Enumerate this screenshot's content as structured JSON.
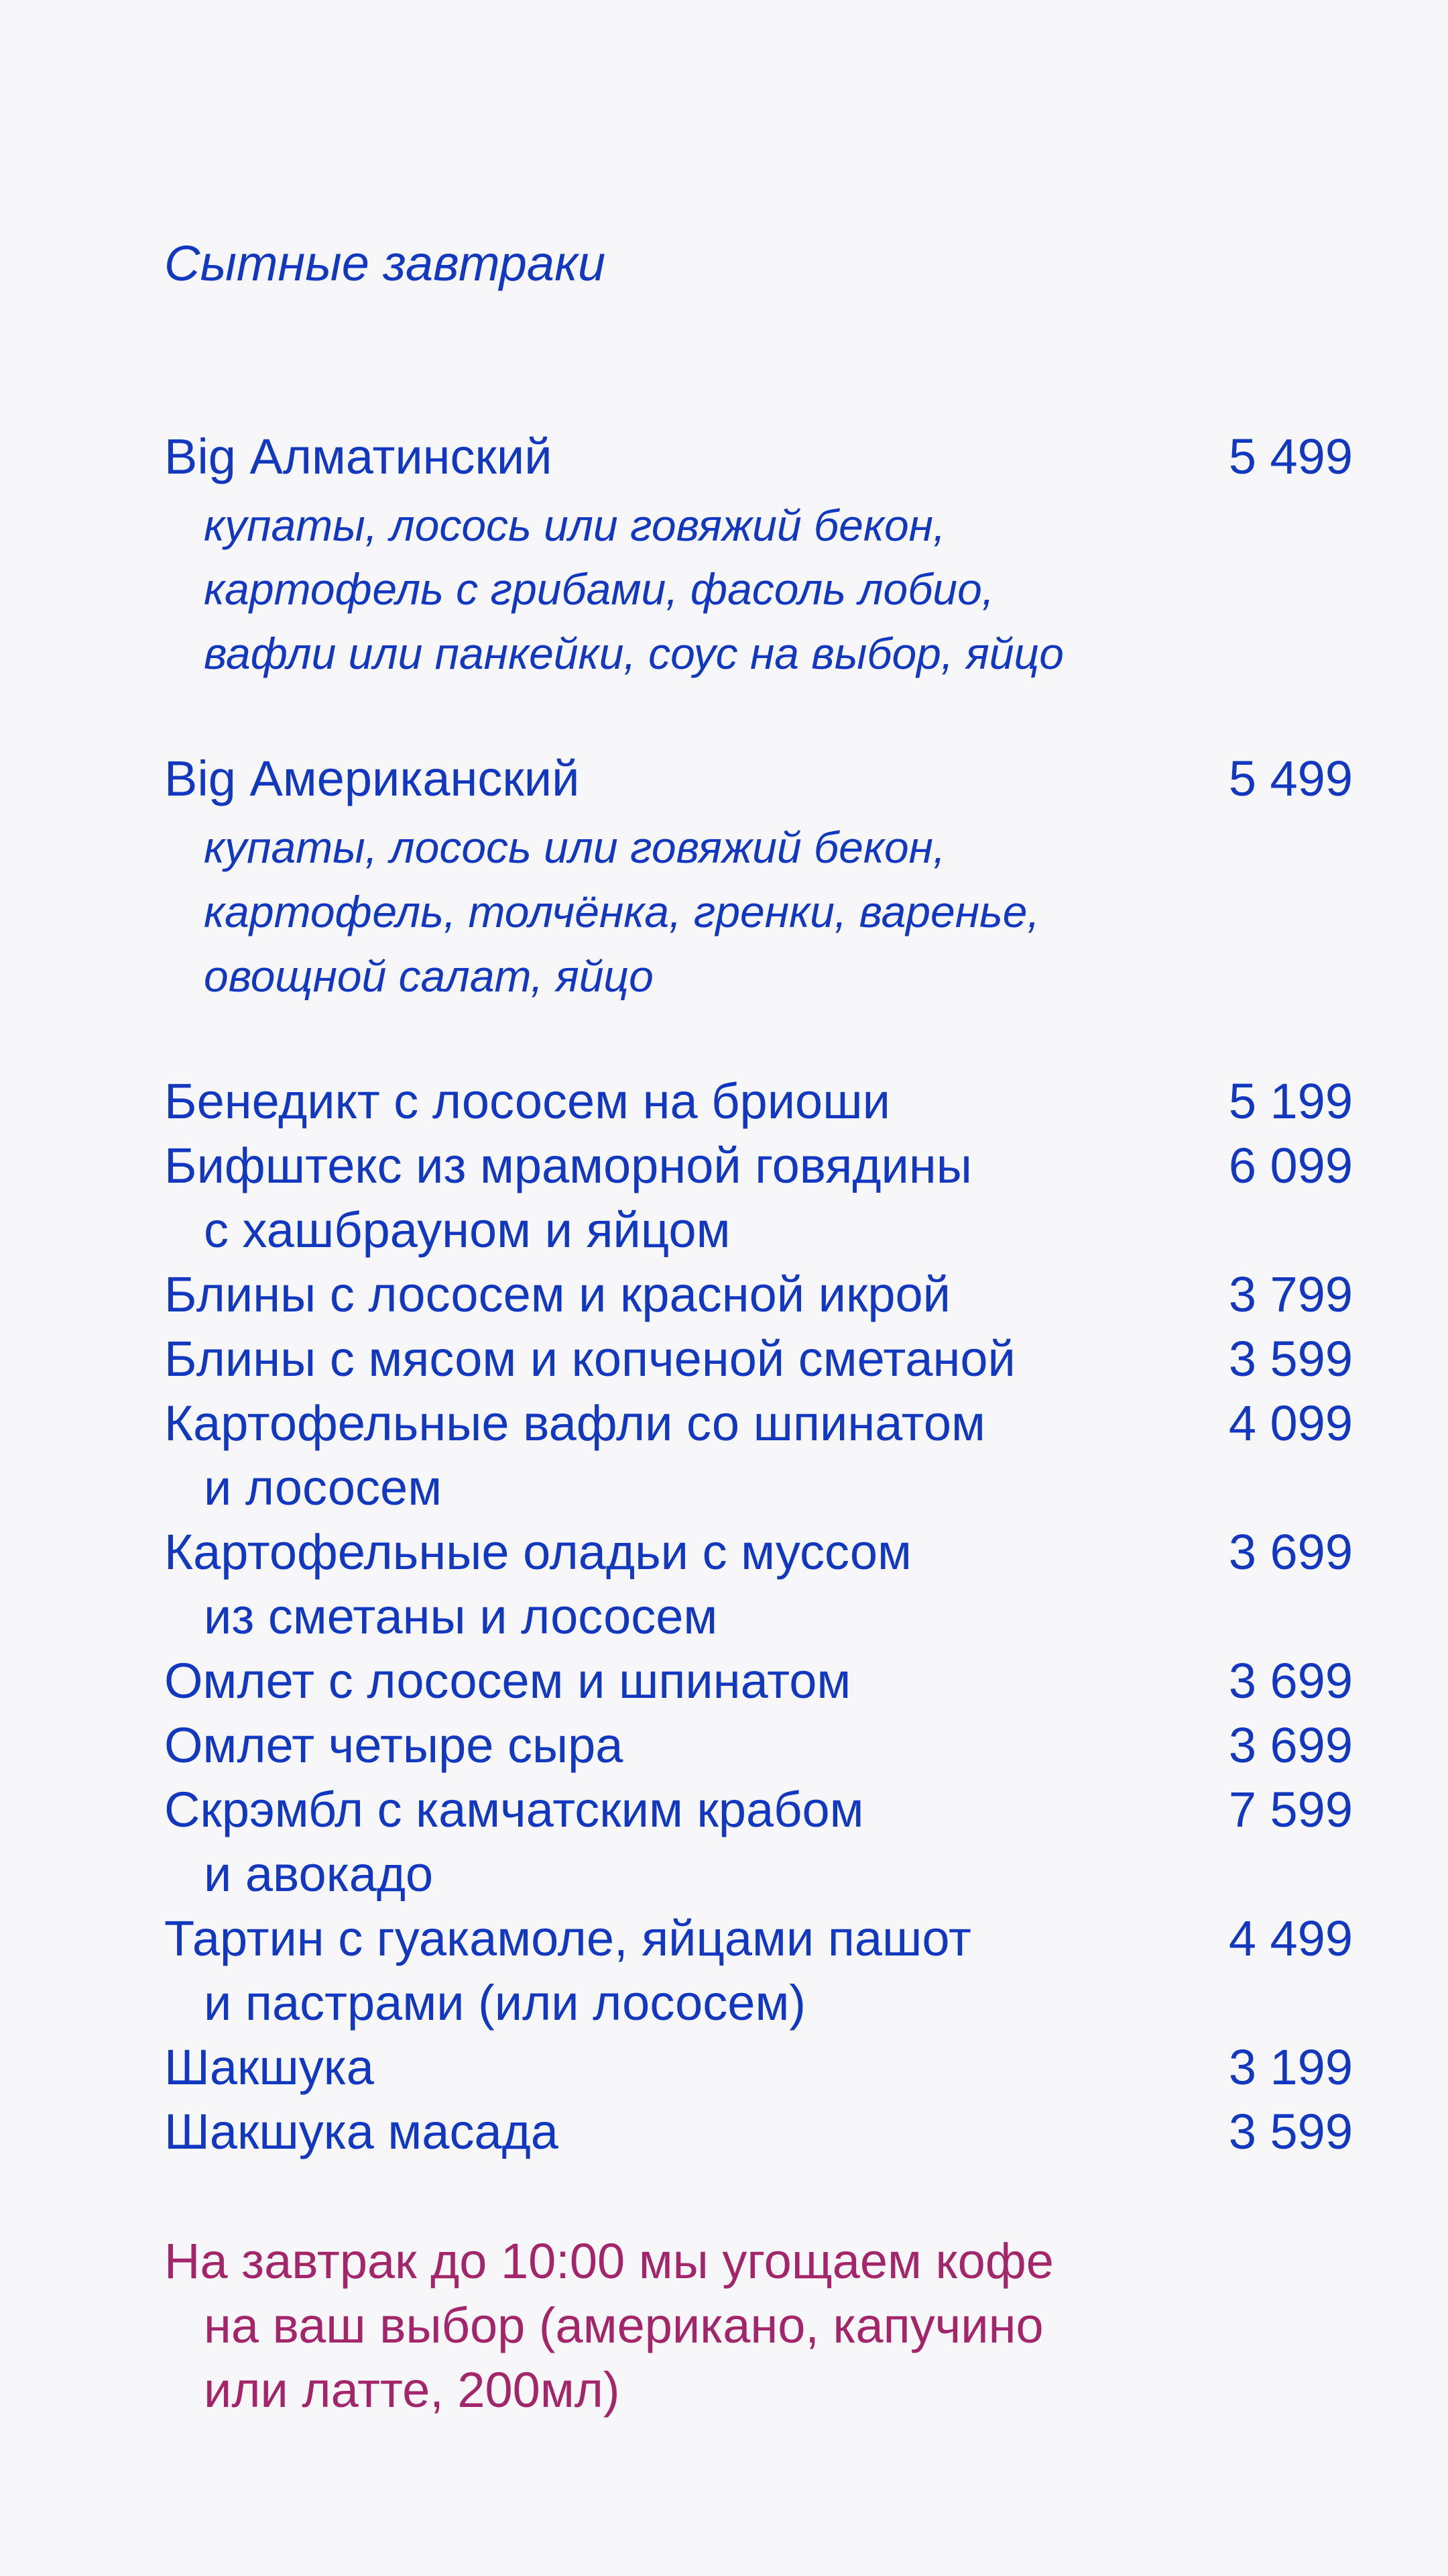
{
  "section_title": "Сытные завтраки",
  "items": [
    {
      "name_lines": [
        "Big Алматинский"
      ],
      "desc_lines": [
        "купаты, лосось или говяжий бекон,",
        "картофель с грибами, фасоль лобио,",
        "вафли или панкейки, соус на выбор, яйцо"
      ],
      "price": "5 499"
    },
    {
      "name_lines": [
        "Big Американский"
      ],
      "desc_lines": [
        "купаты, лосось или говяжий бекон,",
        "картофель, толчёнка, гренки, варенье,",
        "овощной салат, яйцо"
      ],
      "price": "5 499"
    },
    {
      "name_lines": [
        "Бенедикт с лососем на бриоши"
      ],
      "price": "5 199"
    },
    {
      "name_lines": [
        "Бифштекс из мраморной говядины",
        "с хашбрауном и яйцом"
      ],
      "price": "6 099"
    },
    {
      "name_lines": [
        "Блины с лососем и красной икрой"
      ],
      "price": "3 799"
    },
    {
      "name_lines": [
        "Блины с мясом и копченой сметаной"
      ],
      "price": "3 599"
    },
    {
      "name_lines": [
        "Картофельные вафли со шпинатом",
        "и лососем"
      ],
      "price": "4 099"
    },
    {
      "name_lines": [
        "Картофельные оладьи с муссом",
        "из сметаны и лососем"
      ],
      "price": "3 699"
    },
    {
      "name_lines": [
        "Омлет с лососем и шпинатом"
      ],
      "price": "3 699"
    },
    {
      "name_lines": [
        "Омлет четыре сыра"
      ],
      "price": "3 699"
    },
    {
      "name_lines": [
        "Скрэмбл с камчатским крабом",
        "и авокадо"
      ],
      "price": "7 599"
    },
    {
      "name_lines": [
        "Тартин с гуакамоле, яйцами пашот",
        "и пастрами (или лососем)"
      ],
      "price": "4 499"
    },
    {
      "name_lines": [
        "Шакшука"
      ],
      "price": "3 199"
    },
    {
      "name_lines": [
        "Шакшука масада"
      ],
      "price": "3 599"
    }
  ],
  "note_lines": [
    "На завтрак до 10:00 мы угощаем кофе",
    "на ваш выбор (американо, капучино",
    "или латте, 200мл)"
  ],
  "colors": {
    "background": "#f7f7fa",
    "text": "#1238bf",
    "note": "#a3266b"
  }
}
